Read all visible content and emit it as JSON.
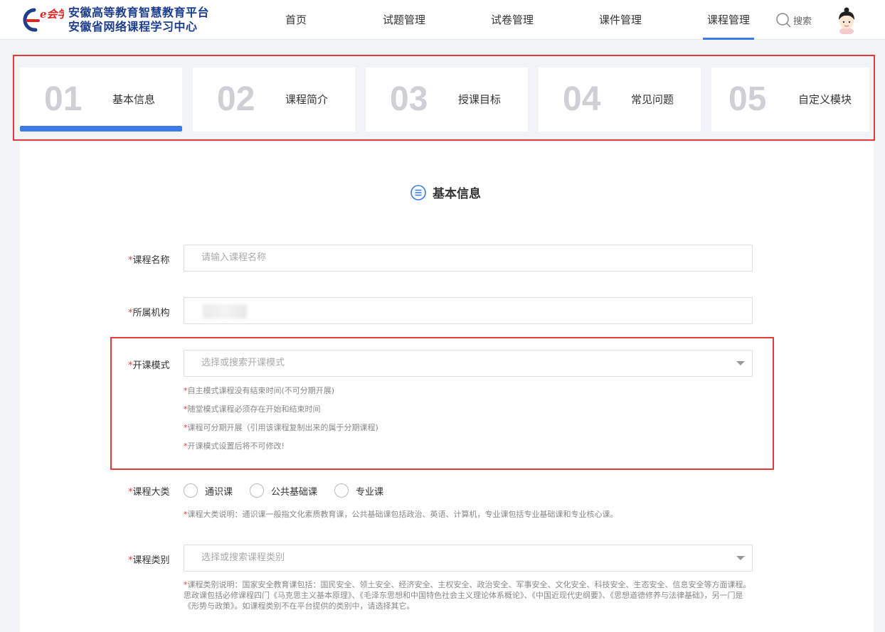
{
  "header": {
    "logo_mark_text": "e会学",
    "logo_line1": "安徽高等教育智慧教育平台",
    "logo_line2": "安徽省网络课程学习中心",
    "nav": [
      "首页",
      "试题管理",
      "试卷管理",
      "课件管理",
      "课程管理"
    ],
    "active_nav": "课程管理",
    "search_label": "搜索"
  },
  "steps": [
    {
      "num": "01",
      "label": "基本信息"
    },
    {
      "num": "02",
      "label": "课程简介"
    },
    {
      "num": "03",
      "label": "授课目标"
    },
    {
      "num": "04",
      "label": "常见问题"
    },
    {
      "num": "05",
      "label": "自定义模块"
    }
  ],
  "active_step": "01",
  "section_title": "基本信息",
  "form": {
    "course_name": {
      "label": "课程名称",
      "placeholder": "请输入课程名称"
    },
    "institution": {
      "label": "所属机构"
    },
    "mode": {
      "label": "开课模式",
      "placeholder": "选择或搜索开课模式",
      "hints": [
        "自主模式课程没有结束时间(不可分期开展)",
        "随堂模式课程必须存在开始和结束时间",
        "课程可分期开展（引用该课程复制出来的属于分期课程)",
        "开课模式设置后将不可修改!"
      ]
    },
    "category_major": {
      "label": "课程大类",
      "options": [
        "通识课",
        "公共基础课",
        "专业课"
      ],
      "hint": "课程大类说明：通识课一般指文化素质教育课，公共基础课包括政治、英语、计算机，专业课包括专业基础课和专业核心课。"
    },
    "category_type": {
      "label": "课程类别",
      "placeholder": "选择或搜索课程类别",
      "hint": "课程类别说明：国家安全教育课包括：国民安全、领土安全、经济安全、主权安全、政治安全、军事安全、文化安全、科技安全、生态安全、信息安全等方面课程。思政课包括必修课程四门《马克思主义基本原理》、《毛泽东思想和中国特色社会主义理论体系概论》、《中国近现代史纲要》、《思想道德修养与法律基础》，另一门是《形势与政策》。如课程类别不在平台提供的类别中，请选择其它。"
    }
  },
  "required_mark": "*",
  "colors": {
    "accent": "#3d7ce8",
    "highlight_border": "#e33b3b",
    "required": "#e33b3b"
  }
}
